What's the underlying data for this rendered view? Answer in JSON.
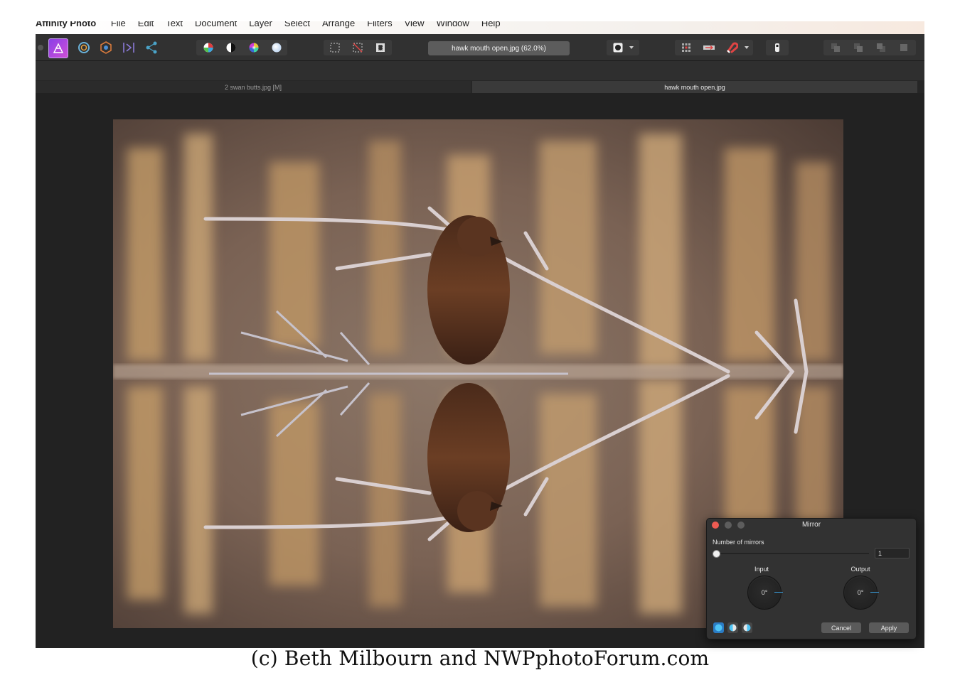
{
  "menu": {
    "app_name": "Affinity Photo",
    "items": [
      "File",
      "Edit",
      "Text",
      "Document",
      "Layer",
      "Select",
      "Arrange",
      "Filters",
      "View",
      "Window",
      "Help"
    ]
  },
  "toolbar": {
    "personas": [
      "photo-persona",
      "liquify-persona",
      "develop-persona",
      "tone-mapping-persona",
      "export-persona"
    ],
    "document_title": "hawk mouth open.jpg (62.0%)"
  },
  "tabs": [
    {
      "label": "2 swan butts.jpg [M]",
      "active": false
    },
    {
      "label": "hawk mouth open.jpg",
      "active": true
    }
  ],
  "dialog": {
    "title": "Mirror",
    "mirrors_label": "Number of mirrors",
    "mirrors_value": "1",
    "mirrors_fraction": 0.0,
    "input_label": "Input",
    "input_value": "0°",
    "output_label": "Output",
    "output_value": "0°",
    "cancel_label": "Cancel",
    "apply_label": "Apply"
  },
  "watermark": "(c) Beth Milbourn and NWPphotoForum.com",
  "colors": {
    "window_bg": "#222222",
    "toolbar_bg": "#313131",
    "accent_blue": "#2b7cc4",
    "close_red": "#ee5b52",
    "persona_purple": "#8a3fe8"
  }
}
